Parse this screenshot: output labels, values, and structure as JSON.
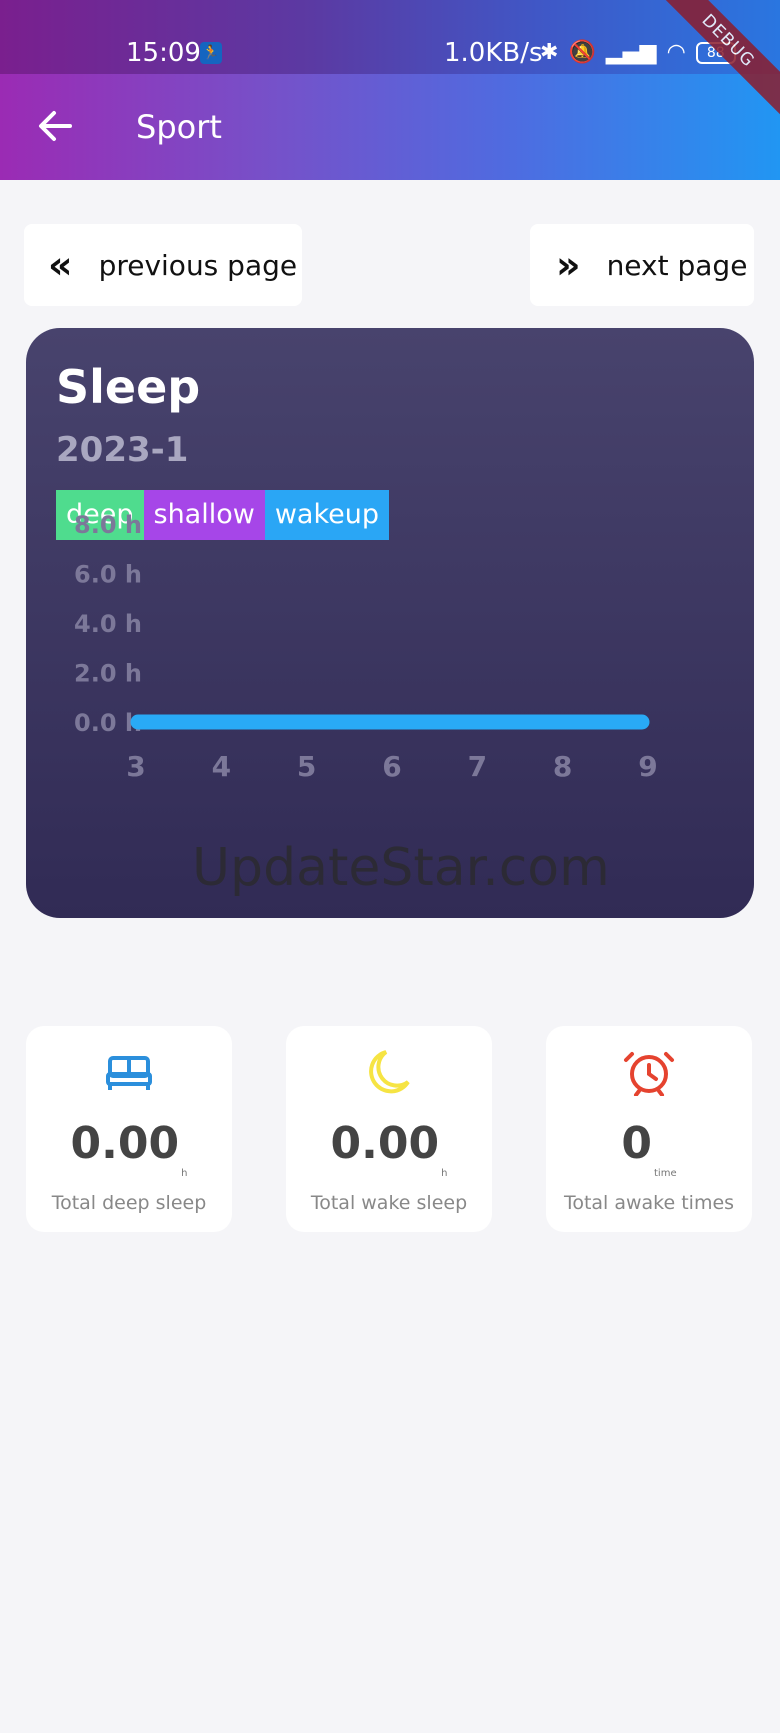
{
  "status_bar": {
    "time": "15:09",
    "speed": "1.0KB/s",
    "battery": "88",
    "icons": [
      "bluetooth-icon",
      "bell-muted-icon",
      "signal-icon",
      "wifi-icon",
      "battery-icon"
    ]
  },
  "debug_banner": "DEBUG",
  "appbar": {
    "title": "Sport"
  },
  "nav": {
    "previous_label": "previous page",
    "next_label": "next page"
  },
  "card": {
    "title": "Sleep",
    "subtitle": "2023-1",
    "legend": [
      {
        "label": "deep",
        "color": "#4fdc8e"
      },
      {
        "label": "shallow",
        "color": "#a646e8"
      },
      {
        "label": "wakeup",
        "color": "#2aa6f5"
      }
    ]
  },
  "chart_data": {
    "type": "bar",
    "y_ticks": [
      "8.0 h",
      "6.0 h",
      "4.0 h",
      "2.0 h",
      "0.0 h"
    ],
    "ylim": [
      0,
      8
    ],
    "categories": [
      "3",
      "4",
      "5",
      "6",
      "7",
      "8",
      "9"
    ],
    "series": [
      {
        "name": "deep",
        "values": [
          0,
          0,
          0,
          0,
          0,
          0,
          0
        ]
      },
      {
        "name": "shallow",
        "values": [
          0,
          0,
          0,
          0,
          0,
          0,
          0
        ]
      },
      {
        "name": "wakeup",
        "values": [
          0,
          0,
          0,
          0,
          0,
          0,
          0
        ]
      }
    ],
    "baseline_color": "#29aaf6"
  },
  "watermark": "UpdateStar.com",
  "stats": [
    {
      "value": "0.00",
      "unit": "h",
      "label": "Total deep sleep",
      "icon": "bed-icon",
      "color": "#2b8fdc"
    },
    {
      "value": "0.00",
      "unit": "h",
      "label": "Total wake sleep",
      "icon": "moon-icon",
      "color": "#f6e443"
    },
    {
      "value": "0",
      "unit": "time",
      "label": "Total awake times",
      "icon": "alarm-clock-icon",
      "color": "#e5432f"
    }
  ]
}
